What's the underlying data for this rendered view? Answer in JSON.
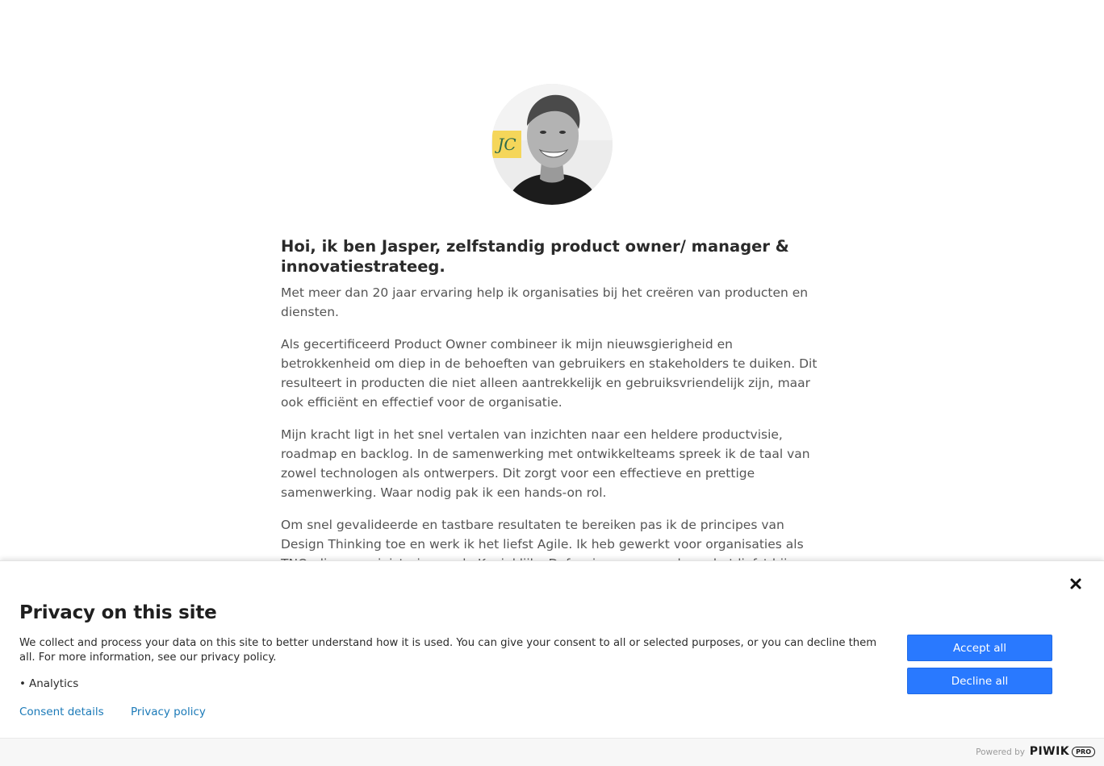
{
  "profile": {
    "headline": "Hoi, ik ben Jasper, zelfstandig product owner/ manager & innovatiestrateeg.",
    "paragraphs": [
      "Met meer dan 20 jaar ervaring help ik organisaties bij het creëren van producten en diensten.",
      "Als gecertificeerd Product Owner combineer ik mijn nieuwsgierigheid en betrokkenheid om diep in de behoeften van gebruikers en stakeholders te duiken. Dit resulteert in producten die niet alleen aantrekkelijk en gebruiksvriendelijk zijn, maar ook efficiënt en effectief voor de organisatie.",
      "Mijn kracht ligt in het snel vertalen van inzichten naar een heldere productvisie, roadmap en backlog. In de samenwerking met ontwikkelteams spreek ik de taal van zowel technologen als ontwerpers. Dit zorgt voor een effectieve en prettige samenwerking. Waar nodig pak ik een hands-on rol.",
      "Om snel gevalideerde en tastbare resultaten te bereiken pas ik de principes van Design Thinking toe en werk ik het liefst Agile. Ik heb gewerkt voor organisaties als TNO, diverse ministeries en de Koninklijke Defensiemusea, en draag het liefst bij aan maatschappelijk"
    ]
  },
  "consent": {
    "title": "Privacy on this site",
    "description": "We collect and process your data on this site to better understand how it is used. You can give your consent to all or selected purposes, or you can decline them all. For more information, see our privacy policy.",
    "purposes": [
      "Analytics"
    ],
    "consent_details_link": "Consent details",
    "privacy_policy_link": "Privacy policy",
    "accept_all_label": "Accept all",
    "decline_all_label": "Decline all",
    "powered_by": "Powered by",
    "brand": "PIWIK",
    "brand_suffix": "PRO",
    "button_color": "#2979ff",
    "link_color": "#1b7ab8"
  }
}
